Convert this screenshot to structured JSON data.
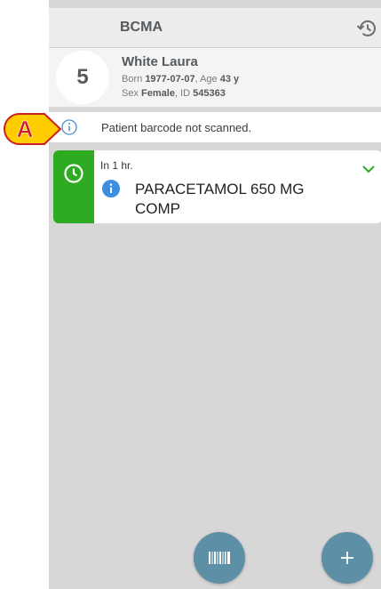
{
  "appbar": {
    "title": "BCMA",
    "history_icon": "history-icon"
  },
  "patient": {
    "bed": "5",
    "name": "White Laura",
    "born_label": "Born",
    "born": "1977-07-07",
    "age_label": ", Age",
    "age": "43 y",
    "sex_label": "Sex",
    "sex": "Female",
    "id_label": ", ID",
    "id": "545363"
  },
  "notice": {
    "icon": "info-outline-icon",
    "text": "Patient barcode not scanned."
  },
  "administration": {
    "status_color": "#2fab22",
    "status_icon": "clock-icon",
    "time": "In 1 hr.",
    "drug": "PARACETAMOL 650 MG COMP",
    "check_icon": "chevron-down-icon"
  },
  "actions": {
    "scan_icon": "barcode-icon",
    "add_icon": "plus-icon",
    "accent": "#5d8fa6"
  },
  "annotation": {
    "label": "A"
  }
}
